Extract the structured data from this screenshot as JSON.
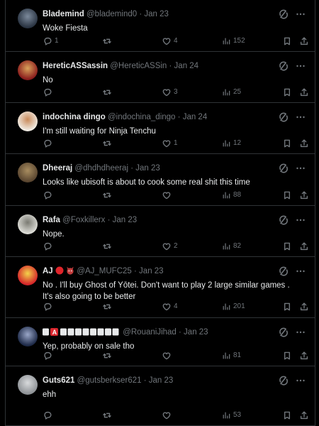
{
  "replies": [
    {
      "name": "Blademind",
      "handle": "@blademind0",
      "time": "Jan 23",
      "text": "Woke Fiesta",
      "replies": "1",
      "reposts": "",
      "likes": "4",
      "views": "152",
      "avatar_color": "#2a3442",
      "avatar_accent": "#7c8a9c",
      "name_suffix": ""
    },
    {
      "name": "HereticASSassin",
      "handle": "@HereticASSin",
      "time": "Jan 24",
      "text": "No",
      "replies": "",
      "reposts": "",
      "likes": "3",
      "views": "25",
      "avatar_color": "#8a1d1d",
      "avatar_accent": "#d9a25a",
      "name_suffix": ""
    },
    {
      "name": "indochina dingo",
      "handle": "@indochina_dingo",
      "time": "Jan 24",
      "text": "I'm still waiting for Ninja Tenchu",
      "replies": "",
      "reposts": "",
      "likes": "1",
      "views": "12",
      "avatar_color": "#f1ece4",
      "avatar_accent": "#c98a5a",
      "name_suffix": ""
    },
    {
      "name": "Dheeraj",
      "handle": "@dhdhdheeraj",
      "time": "Jan 23",
      "text": "Looks like ubisoft is about to cook some real shit this time",
      "replies": "",
      "reposts": "",
      "likes": "",
      "views": "88",
      "avatar_color": "#5a4630",
      "avatar_accent": "#a88d60",
      "name_suffix": ""
    },
    {
      "name": "Rafa",
      "handle": "@Foxkillerx",
      "time": "Jan 23",
      "text": "Nope.",
      "replies": "",
      "reposts": "",
      "likes": "2",
      "views": "82",
      "avatar_color": "#dcdcd6",
      "avatar_accent": "#7a7a72",
      "name_suffix": ""
    },
    {
      "name": "AJ",
      "handle": "@AJ_MUFC25",
      "time": "Jan 23",
      "text": "No . I'll buy Ghost of Yōtei. Don't want to play 2 large similar games . It's also going to be better",
      "replies": "",
      "reposts": "",
      "likes": "4",
      "views": "201",
      "avatar_color": "#d4252a",
      "avatar_accent": "#f3d34a",
      "name_suffix": "red-circle devil"
    },
    {
      "name": "",
      "handle": "@RouaniJihad",
      "time": "Jan 23",
      "text": "Yep, probably on sale tho",
      "replies": "",
      "reposts": "",
      "likes": "",
      "views": "81",
      "avatar_color": "#1e2a48",
      "avatar_accent": "#9aa7c8",
      "name_suffix": "squares"
    },
    {
      "name": "Guts621",
      "handle": "@gutsberkser621",
      "time": "Jan 23",
      "text": "ehh",
      "replies": "",
      "reposts": "",
      "likes": "",
      "views": "53",
      "avatar_color": "#8e9296",
      "avatar_accent": "#d8dadc",
      "name_suffix": ""
    }
  ]
}
